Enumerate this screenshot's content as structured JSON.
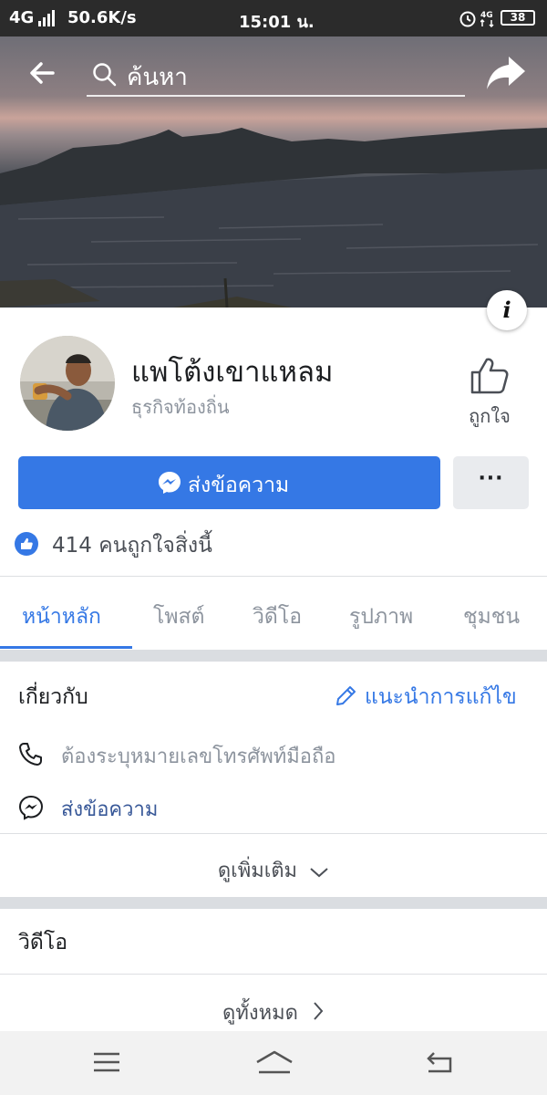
{
  "status_bar": {
    "network": "4G",
    "speed": "50.6K/s",
    "time": "15:01 น.",
    "battery": "38"
  },
  "search": {
    "placeholder": "ค้นหา"
  },
  "page": {
    "name": "แพโต้งเขาแหลม",
    "category": "ธุรกิจท้องถิ่น",
    "like_label": "ถูกใจ"
  },
  "actions": {
    "message_label": "ส่งข้อความ",
    "more_label": "···"
  },
  "likes_text": "414 คนถูกใจสิ่งนี้",
  "tabs": [
    {
      "label": "หน้าหลัก"
    },
    {
      "label": "โพสต์"
    },
    {
      "label": "วิดีโอ"
    },
    {
      "label": "รูปภาพ"
    },
    {
      "label": "ชุมชน"
    }
  ],
  "about": {
    "title": "เกี่ยวกับ",
    "suggest_edit": "แนะนำการแก้ไข",
    "phone_text": "ต้องระบุหมายเลขโทรศัพท์มือถือ",
    "messenger_text": "ส่งข้อความ",
    "see_more": "ดูเพิ่มเติม"
  },
  "videos": {
    "title": "วิดีโอ",
    "see_all": "ดูทั้งหมด"
  },
  "colors": {
    "accent": "#3578e5",
    "link": "#385898",
    "muted": "#8d949e"
  }
}
